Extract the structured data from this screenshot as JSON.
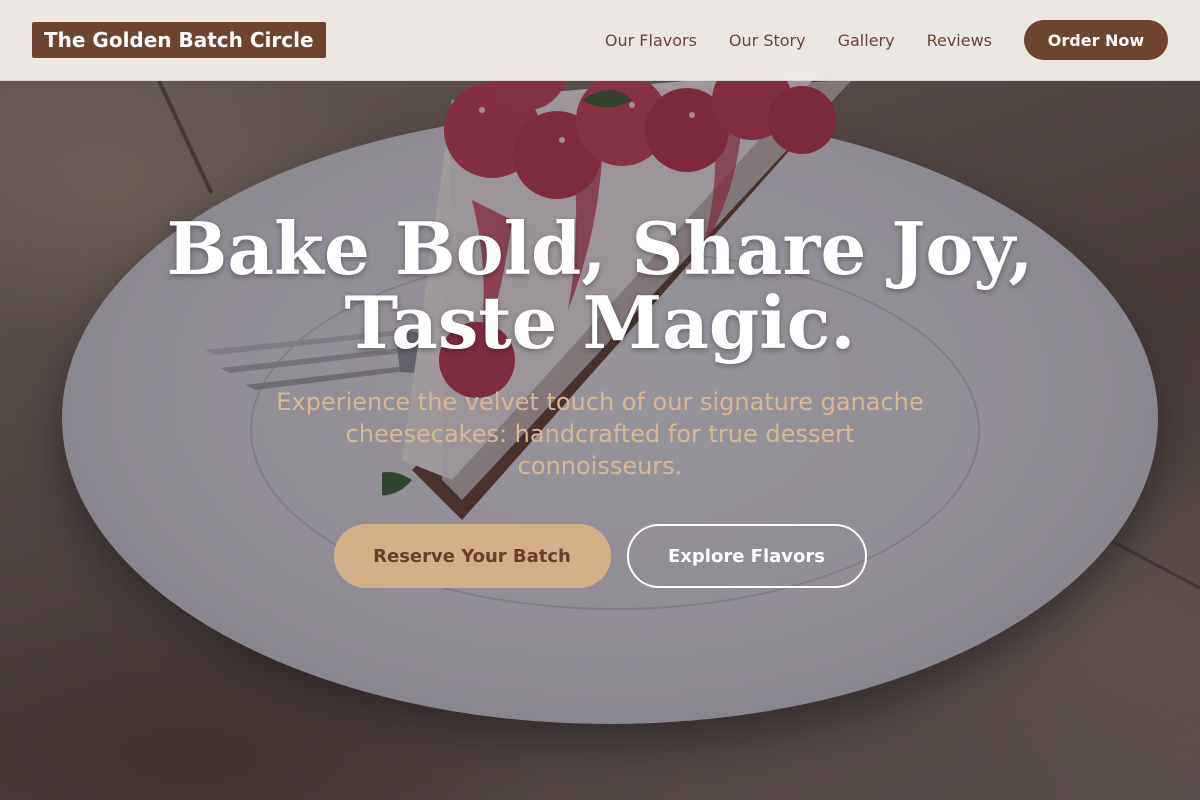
{
  "navbar": {
    "brand": "The Golden Batch Circle",
    "links": [
      "Our Flavors",
      "Our Story",
      "Gallery",
      "Reviews"
    ],
    "cta": "Order Now"
  },
  "hero": {
    "headline_line1": "Bake Bold, Share Joy,",
    "headline_line2": "Taste Magic.",
    "subheadline": "Experience the velvet touch of our signature ganache cheesecakes: handcrafted for true dessert connoisseurs.",
    "primary_button": "Reserve Your Batch",
    "secondary_button": "Explore Flavors",
    "background_image": "cheesecake-slice-with-raspberries-on-white-plate"
  },
  "colors": {
    "brand_brown": "#6d4430",
    "accent_tan": "#d2b08a",
    "subhead_tan": "#d8b894",
    "nav_bg": "#f1ece8"
  }
}
